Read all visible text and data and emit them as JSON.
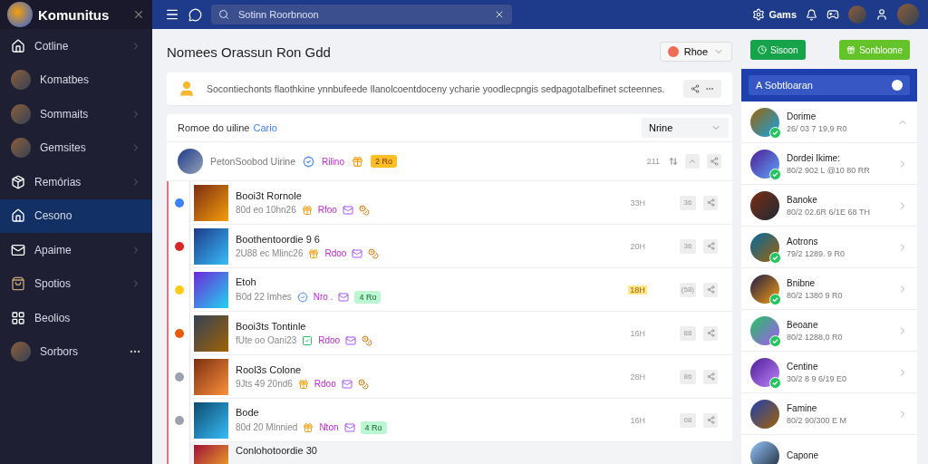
{
  "sidebar": {
    "title": "Komunitus",
    "items": [
      {
        "label": "Cotline",
        "kind": "home",
        "chevron": true,
        "more": false,
        "selected": false
      },
      {
        "label": "Komatbes",
        "kind": "avatar",
        "chevron": false,
        "more": false,
        "selected": false
      },
      {
        "label": "Sommaits",
        "kind": "avatar",
        "chevron": true,
        "more": false,
        "selected": false
      },
      {
        "label": "Gemsites",
        "kind": "avatar",
        "chevron": true,
        "more": false,
        "selected": false
      },
      {
        "label": "Remórias",
        "kind": "box",
        "chevron": true,
        "more": false,
        "selected": false
      },
      {
        "label": "Cesono",
        "kind": "home",
        "chevron": false,
        "more": false,
        "selected": true
      },
      {
        "label": "Apaime",
        "kind": "mail",
        "chevron": true,
        "more": false,
        "selected": false
      },
      {
        "label": "Spotios",
        "kind": "bag",
        "chevron": true,
        "more": false,
        "selected": false
      },
      {
        "label": "Beolios",
        "kind": "grid",
        "chevron": false,
        "more": false,
        "selected": false
      },
      {
        "label": "Sorbors",
        "kind": "avatar",
        "chevron": false,
        "more": true,
        "selected": false
      }
    ]
  },
  "topbar": {
    "search": {
      "placeholder": "Sotinn Roorbnoon"
    },
    "games_label": "Gams"
  },
  "page": {
    "title": "Nomees Orassun Ron Gdd",
    "filter": "Rhoe"
  },
  "notice": {
    "text": "Socontiechonts flaothkine ynnbufeede Ilanolcoentdoceny ycharie yoodlecpngis sedpagotalbefinet scteennes."
  },
  "list": {
    "heading": "Romoe do uiline",
    "link": "Cario",
    "sort": "Nrine",
    "pinned": {
      "name": "PetonSoobod Uirine",
      "tag": "Rilino",
      "badge": "2 Ro",
      "count": "211"
    },
    "rows": [
      {
        "title": "Booi3t Rornole",
        "meta": "80d eo 10hn26",
        "kind": "gift",
        "tag": "Rfoo",
        "time": "33H",
        "count": "36",
        "color": "#3b82f6",
        "highlighted": false
      },
      {
        "title": "Boothentoordie 9 6",
        "meta": "2U88 ec Mlinc26",
        "kind": "gift",
        "tag": "Rdoo",
        "time": "20H",
        "count": "36",
        "color": "#dc2626",
        "highlighted": false
      },
      {
        "title": "Etoh",
        "meta": "B0d 22 Imhes",
        "kind": "verified",
        "tag": "Nro .",
        "badge": "4 Ro",
        "time": "18H",
        "count": "(58)",
        "color": "#facc15",
        "highlighted": true
      },
      {
        "title": "Booi3ts Tontinle",
        "meta": "fUte oo Oani23",
        "kind": "check",
        "tag": "Rdoo",
        "time": "16H",
        "count": "88",
        "color": "#ea580c",
        "highlighted": false
      },
      {
        "title": "Rool3s Colone",
        "meta": "9Jts 49 20nd6",
        "kind": "gift",
        "tag": "Rdoo",
        "time": "28H",
        "count": "86",
        "color": "#9ca3af",
        "highlighted": false
      },
      {
        "title": "Bode",
        "meta": "80d 20 Mlnnied",
        "kind": "gift",
        "tag": "Nton",
        "badge": "4 Ro",
        "time": "16H",
        "count": "08",
        "color": "#9ca3af",
        "highlighted": false
      }
    ],
    "more_row": {
      "title": "Conlohotoordie 30"
    }
  },
  "side_panel": {
    "buttons": [
      {
        "label": "Sisoon",
        "kind": "primary"
      },
      {
        "label": "Sonbloone",
        "kind": "secondary"
      }
    ],
    "card_title": "A Sobtloaran",
    "users": [
      {
        "name": "Dorime",
        "detail": "26/ 03 7 19,9 R0",
        "online": true,
        "expanded": true
      },
      {
        "name": "Dordei Ikime:",
        "detail": "80/2 902 L @10 80 RR",
        "online": true,
        "expanded": false
      },
      {
        "name": "Banoke",
        "detail": "80/2 02.6R 6/1E 68 TH",
        "online": false,
        "expanded": false
      },
      {
        "name": "Aotrons",
        "detail": "79/2 1289. 9 R0",
        "online": true,
        "expanded": false
      },
      {
        "name": "Bnibne",
        "detail": "80/2 1380 9 R0",
        "online": true,
        "expanded": false
      },
      {
        "name": "Beoane",
        "detail": "80/2 1288,0 R0",
        "online": true,
        "expanded": false
      },
      {
        "name": "Centine",
        "detail": "30/2 8 9 6/19 E0",
        "online": true,
        "expanded": false
      },
      {
        "name": "Famine",
        "detail": "80/2 90/300 E M",
        "online": false,
        "expanded": false
      }
    ],
    "more_user": {
      "name": "Capone"
    }
  }
}
